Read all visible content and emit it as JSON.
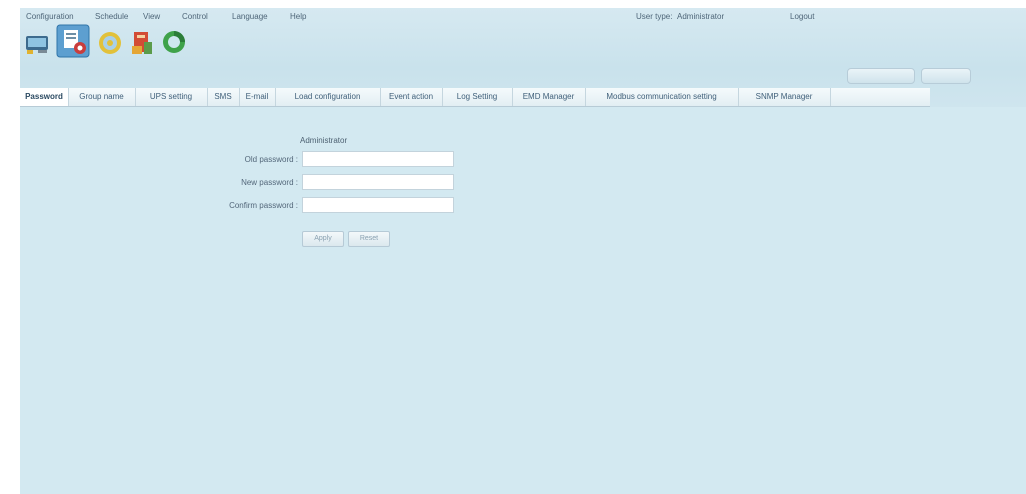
{
  "menu": {
    "items": [
      "Configuration",
      "Schedule",
      "View",
      "Control",
      "Language",
      "Help"
    ]
  },
  "user": {
    "type_label": "User type:",
    "type_value": "Administrator",
    "logout": "Logout"
  },
  "toolbar": {
    "icons": [
      "monitor-icon",
      "configuration-icon",
      "control-icon",
      "log-icon",
      "refresh-icon"
    ]
  },
  "tabs": [
    "Password",
    "Group name",
    "UPS setting",
    "SMS",
    "E-mail",
    "Load configuration",
    "Event action",
    "Log Setting",
    "EMD Manager",
    "Modbus communication setting",
    "SNMP Manager"
  ],
  "form": {
    "title": "Administrator",
    "old_password_label": "Old password :",
    "new_password_label": "New password :",
    "confirm_password_label": "Confirm password :",
    "apply_label": "Apply",
    "reset_label": "Reset"
  },
  "colors": {
    "background": "#d3e9f1",
    "active_tab": "#ffffff"
  }
}
